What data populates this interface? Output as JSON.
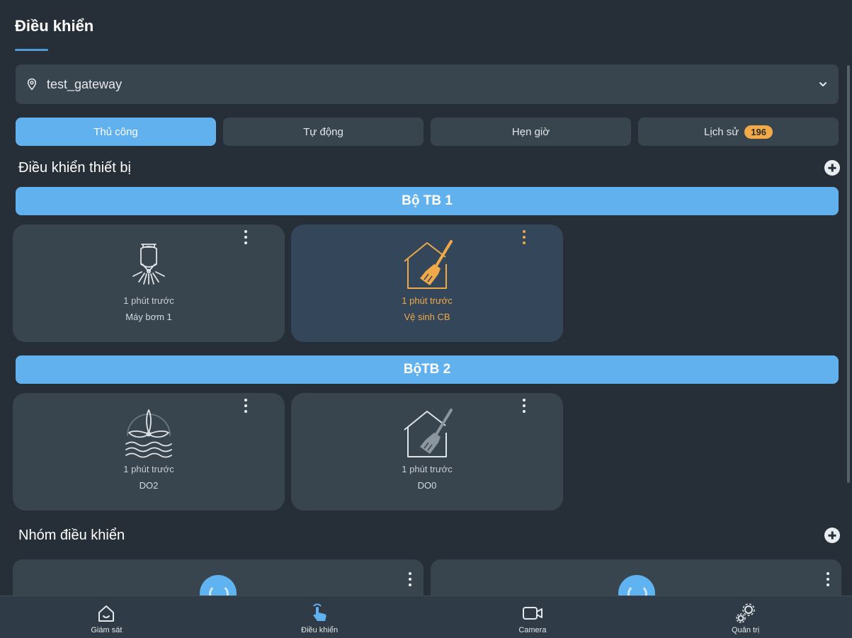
{
  "header": {
    "title": "Điều khiển"
  },
  "location": {
    "value": "test_gateway",
    "pin_icon": "map-pin-icon",
    "chevron_icon": "chevron-down-icon"
  },
  "tabs": [
    {
      "label": "Thủ công",
      "active": true
    },
    {
      "label": "Tự động",
      "active": false
    },
    {
      "label": "Hẹn giờ",
      "active": false
    },
    {
      "label": "Lịch sử",
      "badge": "196",
      "active": false
    }
  ],
  "devices_section": {
    "title": "Điều khiển thiết bị"
  },
  "groups": [
    {
      "name": "Bộ TB 1",
      "devices": [
        {
          "time": "1 phút trước",
          "name": "Máy bơm 1",
          "icon": "pump-icon",
          "active": false
        },
        {
          "time": "1 phút trước",
          "name": "Vệ sinh CB",
          "icon": "broom-house-icon",
          "active": true
        }
      ]
    },
    {
      "name": "BộTB 2",
      "devices": [
        {
          "time": "1 phút trước",
          "name": "DO2",
          "icon": "aerator-fan-icon",
          "active": false
        },
        {
          "time": "1 phút trước",
          "name": "DO0",
          "icon": "broom-house-icon",
          "active": false
        }
      ]
    }
  ],
  "control_groups_section": {
    "title": "Nhóm điều khiển"
  },
  "bottom_nav": [
    {
      "label": "Giám sát",
      "icon": "home-icon"
    },
    {
      "label": "Điều khiển",
      "icon": "touch-hand-icon"
    },
    {
      "label": "Camera",
      "icon": "video-camera-icon"
    },
    {
      "label": "Quản trị",
      "icon": "gears-icon"
    }
  ],
  "colors": {
    "accent": "#62b1ef",
    "badge": "#f3a947",
    "active_device": "#f0a948",
    "background": "#262f38",
    "card": "#38454f"
  }
}
